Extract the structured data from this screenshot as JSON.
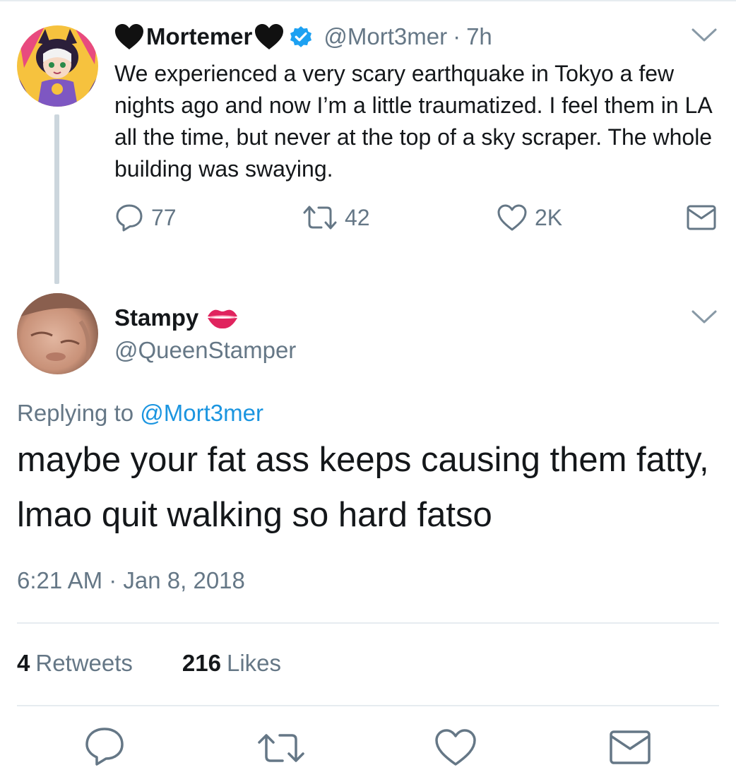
{
  "original_tweet": {
    "display_name": "Mortemer",
    "handle": "@Mort3mer",
    "separator": "·",
    "time": "7h",
    "text": "We experienced a very scary earthquake in Tokyo a few nights ago and now I’m a little traumatized. I feel them in LA all the time, but never at the top of a sky scraper. The whole building was swaying.",
    "actions": {
      "replies": "77",
      "retweets": "42",
      "likes": "2K"
    }
  },
  "reply_tweet": {
    "display_name": "Stampy",
    "handle": "@QueenStamper",
    "replying_prefix": "Replying to",
    "replying_handle": "@Mort3mer",
    "text": "maybe your fat ass keeps causing them fatty, lmao quit walking so hard fatso",
    "timestamp": "6:21 AM · Jan 8, 2018",
    "stats": {
      "retweets_count": "4",
      "retweets_label": "Retweets",
      "likes_count": "216",
      "likes_label": "Likes"
    }
  },
  "icons": {
    "heart_emoji": "black-heart-icon",
    "verified": "verified-badge-icon",
    "kiss_emoji": "kiss-mark-icon",
    "reply": "reply-icon",
    "retweet": "retweet-icon",
    "like": "like-icon",
    "dm": "envelope-icon",
    "more": "chevron-down-icon"
  },
  "colors": {
    "text": "#14171a",
    "secondary": "#657786",
    "link": "#1b95e0",
    "verified": "#1da1f2",
    "divider": "#e6ecf0",
    "kiss": "#e0245e"
  }
}
